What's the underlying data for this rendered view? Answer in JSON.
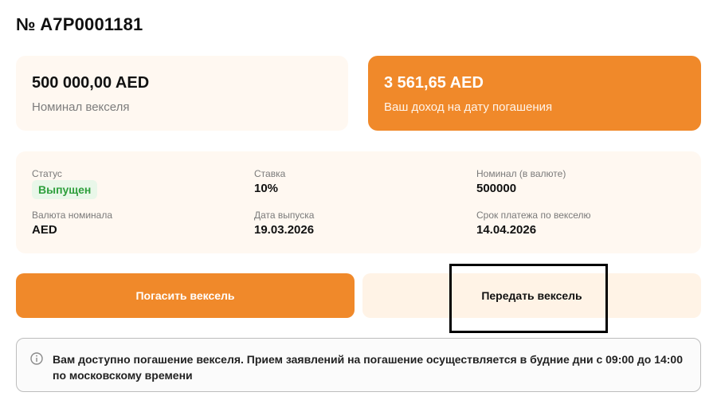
{
  "header": {
    "title": "№ A7P0001181"
  },
  "summary": {
    "nominal": {
      "amount": "500 000,00 AED",
      "caption": "Номинал векселя"
    },
    "income": {
      "amount": "3 561,65 AED",
      "caption": "Ваш доход на дату погашения"
    }
  },
  "details": {
    "status": {
      "label": "Статус",
      "value": "Выпущен"
    },
    "rate": {
      "label": "Ставка",
      "value": "10%"
    },
    "nominal_currency_amount": {
      "label": "Номинал (в валюте)",
      "value": "500000"
    },
    "currency": {
      "label": "Валюта номинала",
      "value": "AED"
    },
    "issue_date": {
      "label": "Дата выпуска",
      "value": "19.03.2026"
    },
    "due_date": {
      "label": "Срок платежа по векселю",
      "value": "14.04.2026"
    }
  },
  "actions": {
    "repay_label": "Погасить вексель",
    "transfer_label": "Передать вексель"
  },
  "notice": {
    "icon": "info-icon",
    "text": "Вам доступно погашение векселя. Прием заявлений на погашение осуществляется в будние дни с 09:00 до 14:00 по московскому времени"
  },
  "colors": {
    "accent": "#f0892a",
    "card_bg": "#fff8f1",
    "status_green": "#2e9f3c"
  }
}
